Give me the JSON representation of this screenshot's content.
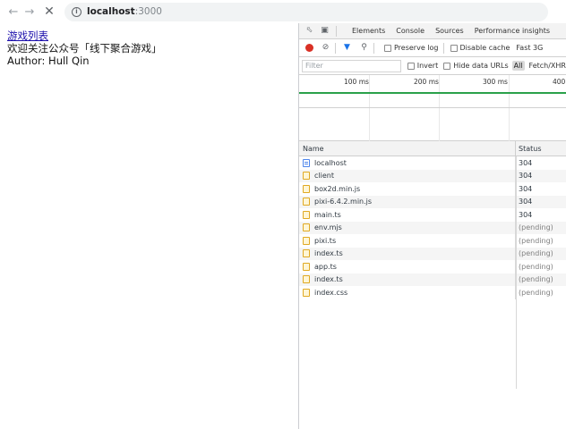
{
  "browser": {
    "url_host": "localhost",
    "url_port": ":3000",
    "back_icon": "arrow-left-icon",
    "forward_icon": "arrow-right-icon",
    "reload_icon": "close-x-icon"
  },
  "page": {
    "link_text": "游戏列表",
    "welcome_text": "欢迎关注公众号「线下聚合游戏」",
    "author_text": "Author: Hull Qin"
  },
  "devtools": {
    "tabs": [
      "Elements",
      "Console",
      "Sources",
      "Performance insights"
    ],
    "toolbar": {
      "preserve_log": "Preserve log",
      "disable_cache": "Disable cache",
      "throttling": "Fast 3G"
    },
    "filter": {
      "placeholder": "Filter",
      "invert": "Invert",
      "hide_data_urls": "Hide data URLs",
      "type_all": "All",
      "type_fetch": "Fetch/XHR"
    },
    "timeline_ticks": [
      "100 ms",
      "200 ms",
      "300 ms",
      "400"
    ],
    "table": {
      "col_name": "Name",
      "col_status": "Status",
      "rows": [
        {
          "name": "localhost",
          "status": "304",
          "type": "doc"
        },
        {
          "name": "client",
          "status": "304",
          "type": "script"
        },
        {
          "name": "box2d.min.js",
          "status": "304",
          "type": "script"
        },
        {
          "name": "pixi-6.4.2.min.js",
          "status": "304",
          "type": "script"
        },
        {
          "name": "main.ts",
          "status": "304",
          "type": "script"
        },
        {
          "name": "env.mjs",
          "status": "(pending)",
          "type": "script"
        },
        {
          "name": "pixi.ts",
          "status": "(pending)",
          "type": "script"
        },
        {
          "name": "index.ts",
          "status": "(pending)",
          "type": "script"
        },
        {
          "name": "app.ts",
          "status": "(pending)",
          "type": "script"
        },
        {
          "name": "index.ts",
          "status": "(pending)",
          "type": "script"
        },
        {
          "name": "index.css",
          "status": "(pending)",
          "type": "style"
        }
      ]
    }
  }
}
